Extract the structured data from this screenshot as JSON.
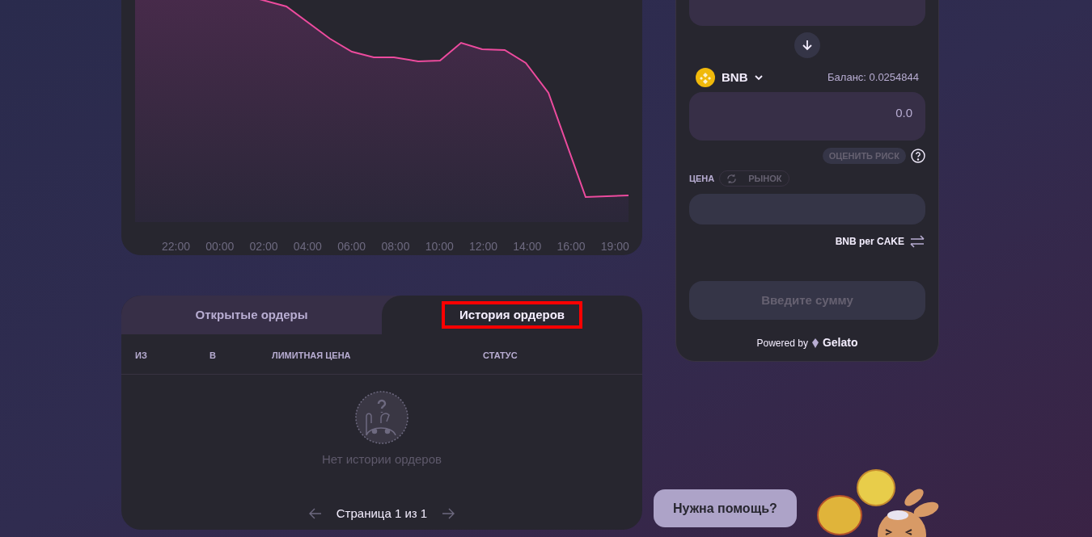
{
  "price_chart": {
    "x_labels": [
      "22:00",
      "00:00",
      "02:00",
      "04:00",
      "06:00",
      "08:00",
      "10:00",
      "12:00",
      "14:00",
      "16:00",
      "19:00"
    ]
  },
  "swap_card": {
    "to_token": {
      "symbol": "BNB",
      "balance": "Баланс: 0.0254844",
      "amount": "0.0"
    },
    "risk_button": "ОЦЕНИТЬ РИСК",
    "price_label": "ЦЕНА",
    "market_button": "РЫНОК",
    "price_unit": "BNB per CAKE",
    "submit_button": {
      "label": "Введите сумму",
      "disabled": true
    },
    "powered_by": "Powered by",
    "provider": "Gelato"
  },
  "orders": {
    "tabs": [
      {
        "label": "Открытые ордеры",
        "selected": false,
        "highlighted": false
      },
      {
        "label": "История ордеров",
        "selected": true,
        "highlighted": true
      }
    ],
    "columns": [
      "ИЗ",
      "В",
      "ЛИМИТНАЯ ЦЕНА",
      "СТАТУС"
    ],
    "empty_message": "Нет истории ордеров",
    "pagination": "Страница 1 из 1"
  },
  "help_bubble": "Нужна помощь?"
}
